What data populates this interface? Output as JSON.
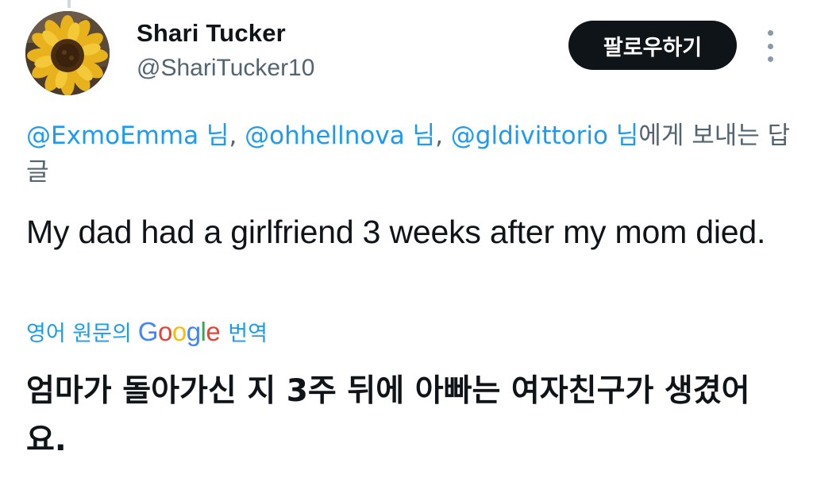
{
  "author": {
    "name": "Shari Tucker",
    "handle": "@ShariTucker10",
    "avatar_icon": "sunflower-avatar"
  },
  "follow_label": "팔로우하기",
  "more_icon": "more-vertical-icon",
  "reply_to": {
    "mentions": [
      {
        "handle": "@ExmoEmma",
        "suffix": " 님"
      },
      {
        "handle": "@ohhellnova",
        "suffix": " 님"
      },
      {
        "handle": "@gldivittorio",
        "suffix": " 님"
      }
    ],
    "separator": ", ",
    "trailing": "에게 보내는 답글"
  },
  "tweet_text": "My dad had a girlfriend 3 weeks after my mom died.",
  "translation": {
    "prefix": "영어 원문의",
    "google_letters": [
      "G",
      "o",
      "o",
      "g",
      "l",
      "e"
    ],
    "suffix": "번역",
    "text": "엄마가 돌아가신 지 3주 뒤에 아빠는 여자친구가 생겼어요."
  },
  "colors": {
    "link": "#1d9bf0",
    "secondary_text": "#536471",
    "button_bg": "#0f1419"
  }
}
